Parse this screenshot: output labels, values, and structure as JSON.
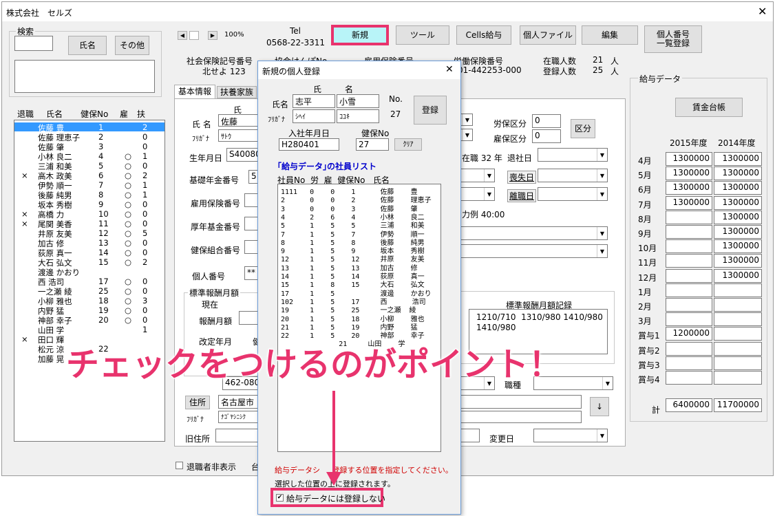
{
  "window": {
    "title": "株式会社　セルズ",
    "close": "✕"
  },
  "search": {
    "label": "検索",
    "name_btn": "氏名",
    "other_btn": "その他"
  },
  "emp_list": {
    "headers": [
      "退職",
      "氏名",
      "健保No",
      "雇",
      "扶"
    ],
    "rows": [
      {
        "x": "",
        "name": "佐藤 豊",
        "no": "1",
        "k": "",
        "f": "2",
        "sel": true
      },
      {
        "x": "",
        "name": "佐藤 理恵子",
        "no": "2",
        "k": "",
        "f": "0"
      },
      {
        "x": "",
        "name": "佐藤 肇",
        "no": "3",
        "k": "",
        "f": "0"
      },
      {
        "x": "",
        "name": "小林 良二",
        "no": "4",
        "k": "○",
        "f": "1"
      },
      {
        "x": "",
        "name": "三浦 和美",
        "no": "5",
        "k": "○",
        "f": "0"
      },
      {
        "x": "×",
        "name": "高木 政美",
        "no": "6",
        "k": "○",
        "f": "2"
      },
      {
        "x": "",
        "name": "伊勢 順一",
        "no": "7",
        "k": "○",
        "f": "1"
      },
      {
        "x": "",
        "name": "後藤 純男",
        "no": "8",
        "k": "○",
        "f": "1"
      },
      {
        "x": "",
        "name": "坂本 秀樹",
        "no": "9",
        "k": "○",
        "f": "0"
      },
      {
        "x": "×",
        "name": "高橋 力",
        "no": "10",
        "k": "○",
        "f": "0"
      },
      {
        "x": "×",
        "name": "尾関 美香",
        "no": "11",
        "k": "○",
        "f": "0"
      },
      {
        "x": "",
        "name": "井原 友美",
        "no": "12",
        "k": "○",
        "f": "5"
      },
      {
        "x": "",
        "name": "加古 修",
        "no": "13",
        "k": "○",
        "f": "0"
      },
      {
        "x": "",
        "name": "荻原 真一",
        "no": "14",
        "k": "○",
        "f": "0"
      },
      {
        "x": "",
        "name": "大石 弘文",
        "no": "15",
        "k": "○",
        "f": "2"
      },
      {
        "x": "",
        "name": "渡邊 かおり",
        "no": "",
        "k": "",
        "f": ""
      },
      {
        "x": "",
        "name": "西 浩司",
        "no": "17",
        "k": "○",
        "f": "0"
      },
      {
        "x": "",
        "name": "一之瀬 綾",
        "no": "25",
        "k": "○",
        "f": "0"
      },
      {
        "x": "",
        "name": "小柳 雅也",
        "no": "18",
        "k": "○",
        "f": "3"
      },
      {
        "x": "",
        "name": "内野 猛",
        "no": "19",
        "k": "○",
        "f": "0"
      },
      {
        "x": "",
        "name": "神部 幸子",
        "no": "20",
        "k": "○",
        "f": "0"
      },
      {
        "x": "",
        "name": "山田 学",
        "no": "",
        "k": "",
        "f": "1"
      },
      {
        "x": "×",
        "name": "田口 輝",
        "no": "",
        "k": "",
        "f": ""
      },
      {
        "x": "",
        "name": "松元 涼",
        "no": "22",
        "k": "",
        "f": ""
      },
      {
        "x": "",
        "name": "加藤 晃",
        "no": "",
        "k": "",
        "f": ""
      }
    ]
  },
  "toolbar": {
    "zoom": "100%",
    "tel_label": "Tel",
    "tel": "0568-22-3311",
    "new": "新規",
    "tool": "ツール",
    "cells": "Cells給与",
    "personal": "個人ファイル",
    "edit": "編集",
    "mynumber": "個人番号\n一覧登録"
  },
  "company": {
    "shaho_label": "社会保険記号番号",
    "shaho": "北せよ 123",
    "kyokai_label": "協会けんぽNo",
    "koyo_label": "雇用保険番号",
    "rodo_label": "労働保険番号",
    "rodo": "01-442253-000",
    "zaishoku_label": "在職人数",
    "zaishoku": "21",
    "touroku_label": "登録人数",
    "touroku": "25",
    "unit": "人"
  },
  "tabs": {
    "basic": "基本情報",
    "family": "扶養家族"
  },
  "form": {
    "sei": "氏",
    "mei": "名",
    "name_label": "氏 名",
    "kana_label": "ﾌﾘｶﾞﾅ",
    "sei_val": "佐藤",
    "kana_val": "ｻﾄｳ",
    "birth_label": "生年月日",
    "birth": "S40080",
    "kiso_label": "基礎年金番号",
    "kiso": "51",
    "koyo_label": "雇用保険番号",
    "kosei_label": "厚年基金番号",
    "kenpo_label": "健保組合番号",
    "kojin_label": "個人番号",
    "kojin": "**",
    "rosai_label": "労保区分",
    "rosai": "0",
    "koyo_k_label": "雇保区分",
    "koyo_k": "0",
    "kubun_btn": "区分",
    "zaishoku_txt": "在職 32 年",
    "taishoku_label": "退社日",
    "soshitsu_label": "喪失日",
    "rishoku_label": "離職日",
    "katsu_txt": "力例 40:00",
    "hyojun_label": "標準報酬月額",
    "genzai_label": "現在",
    "hoshu_label": "報酬月額",
    "kaitei_label": "改定年月",
    "ken_label": "健",
    "hyojun_rec_label": "標準報酬月額記録",
    "hyojun_rec": "1210/710  1310/980 1410/980\n1410/980",
    "zip": "462-0804",
    "addr_btn": "住所",
    "addr": "名古屋市",
    "addr_kana": "ﾅｺﾞﾔｼﾆｼｸ",
    "kyu_label": "旧住所",
    "shokushu_label": "職種",
    "henko_label": "変更日",
    "arrow": "↓",
    "retired_hide": "退職者非表示",
    "dai": "台"
  },
  "salary": {
    "title": "給与データ",
    "ledger_btn": "賃金台帳",
    "y1": "2015年度",
    "y2": "2014年度",
    "rows": [
      {
        "m": "4月",
        "a": "1300000",
        "b": "1300000"
      },
      {
        "m": "5月",
        "a": "1300000",
        "b": "1300000"
      },
      {
        "m": "6月",
        "a": "1300000",
        "b": "1300000"
      },
      {
        "m": "7月",
        "a": "1300000",
        "b": "1300000"
      },
      {
        "m": "8月",
        "a": "",
        "b": "1300000"
      },
      {
        "m": "9月",
        "a": "",
        "b": "1300000"
      },
      {
        "m": "10月",
        "a": "",
        "b": "1300000"
      },
      {
        "m": "11月",
        "a": "",
        "b": "1300000"
      },
      {
        "m": "12月",
        "a": "",
        "b": "1300000"
      },
      {
        "m": "1月",
        "a": "",
        "b": ""
      },
      {
        "m": "2月",
        "a": "",
        "b": ""
      },
      {
        "m": "3月",
        "a": "",
        "b": ""
      },
      {
        "m": "賞与1",
        "a": "1200000",
        "b": ""
      },
      {
        "m": "賞与2",
        "a": "",
        "b": ""
      },
      {
        "m": "賞与3",
        "a": "",
        "b": ""
      },
      {
        "m": "賞与4",
        "a": "",
        "b": ""
      }
    ],
    "total_label": "計",
    "total_a": "6400000",
    "total_b": "11700000"
  },
  "dialog": {
    "title": "新規の個人登録",
    "close": "✕",
    "sei": "氏",
    "mei": "名",
    "name_label": "氏名",
    "kana_label": "ﾌﾘｶﾞﾅ",
    "sei_val": "志平",
    "mei_val": "小雪",
    "sei_kana": "ｼﾍｲ",
    "mei_kana": "ｺﾕｷ",
    "no_label": "No.",
    "no_val": "27",
    "register": "登録",
    "hire_label": "入社年月日",
    "hire": "H280401",
    "kenpo_label": "健保No",
    "kenpo": "27",
    "clear": "ｸﾘｱ",
    "list_title": "｢給与データ｣の社員リスト",
    "list_headers": "社員No  労  雇  健保No   氏名",
    "list": [
      "1111   0    0    1      佐藤    豊",
      "2      0    0    2      佐藤    理恵子",
      "3      0    0    3      佐藤    肇",
      "4      2    6    4      小林    良二",
      "5      1    5    5      三浦    和美",
      "7      1    5    7      伊勢    順一",
      "8      1    5    8      後藤    純男",
      "9      1    5    9      坂本    秀樹",
      "12     1    5    12     井原    友美",
      "13     1    5    13     加古    修",
      "14     1    5    14     荻原    真一",
      "15     1    8    15     大石    弘文",
      "17     1    5           渡邊    かおり",
      "102    1    5    17     西      浩司",
      "19     1    5    25     一之瀬  綾",
      "20     1    5    18     小柳    雅也",
      "21     1    5    19     内野    猛",
      "22     1    5    20     神部    幸子",
      "              21     山田    学"
    ],
    "note1": "給与データシ     登録する位置を指定してください。",
    "note2": "選択した位置の上に登録されます。",
    "checkbox": "給与データには登録しない"
  },
  "annotation": "チェックをつけるのがポイント！"
}
